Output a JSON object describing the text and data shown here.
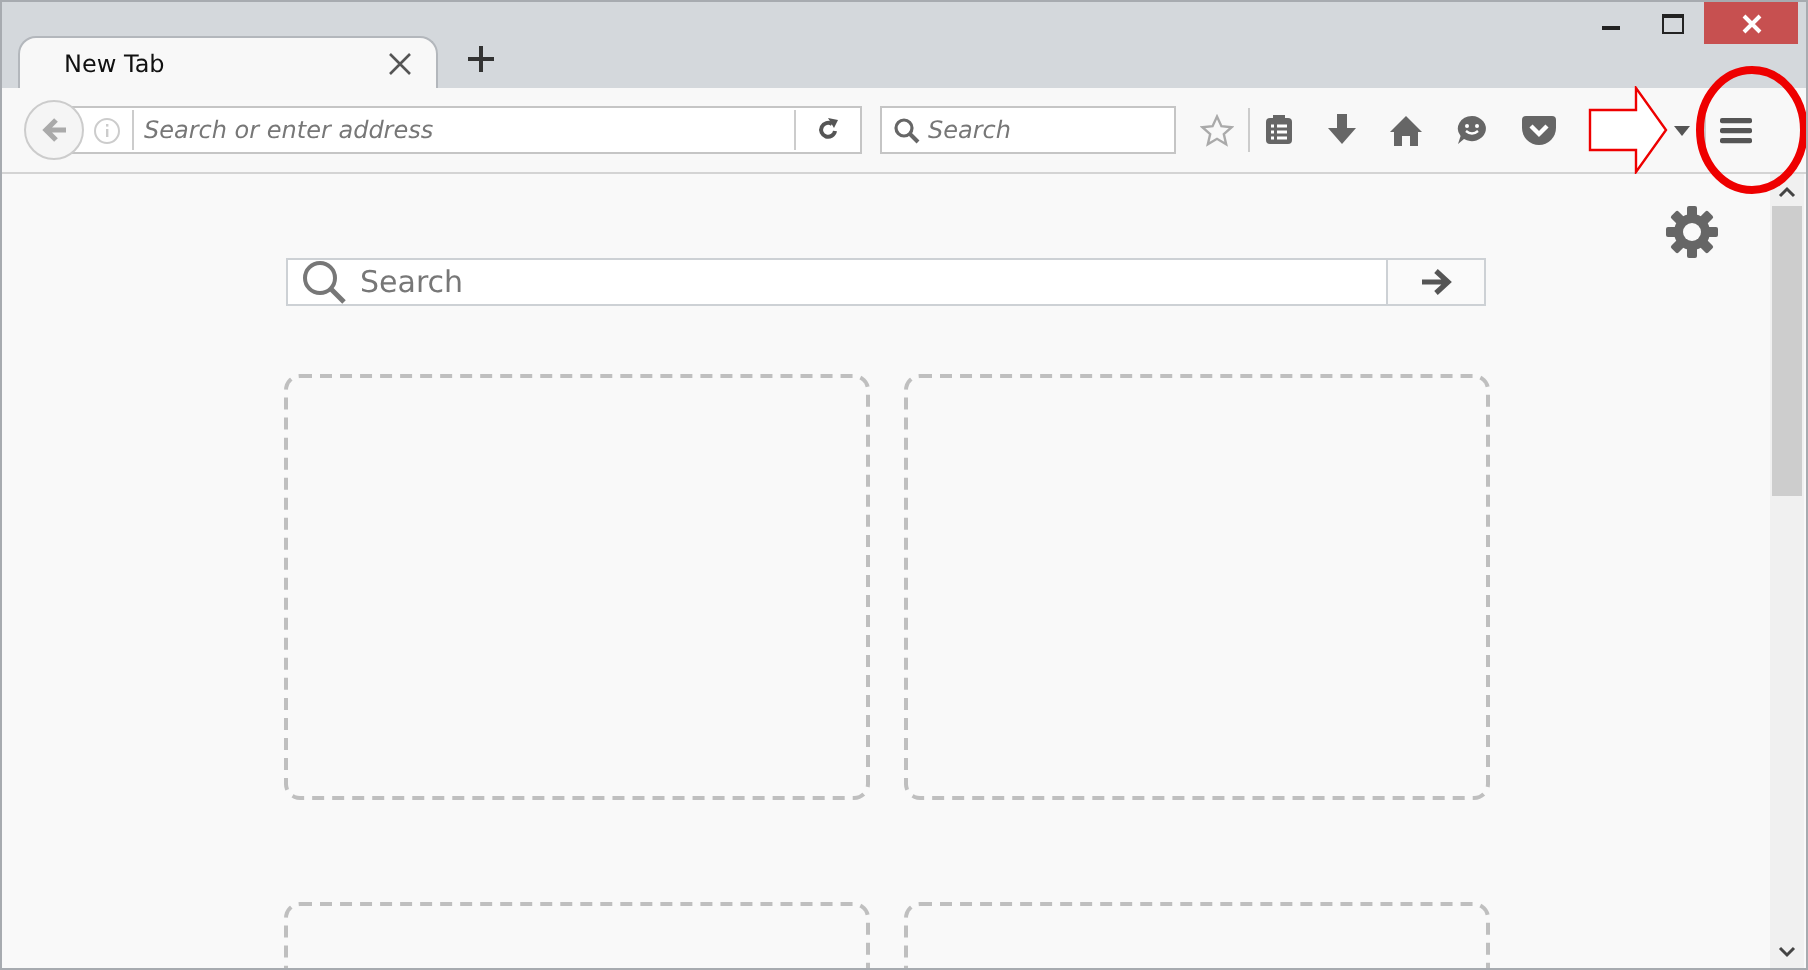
{
  "tabs": [
    {
      "label": "New Tab",
      "selected": true
    }
  ],
  "address_bar": {
    "placeholder": "Search or enter address"
  },
  "search_bar": {
    "placeholder": "Search"
  },
  "new_tab_page": {
    "search": {
      "placeholder": "Search"
    }
  }
}
